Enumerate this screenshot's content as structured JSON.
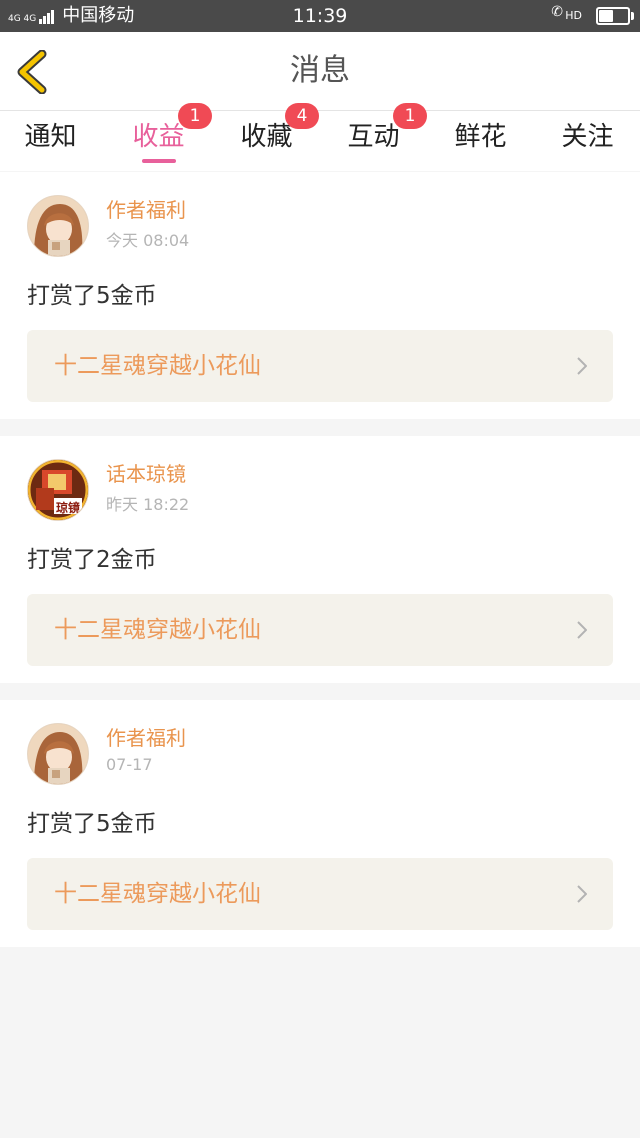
{
  "status_bar": {
    "network": "4G 4G",
    "carrier": "中国移动",
    "time": "11:39",
    "hd_label": "HD",
    "battery_level": 0.5
  },
  "header": {
    "title": "消息",
    "back_icon": "chevron-left-icon"
  },
  "tabs": [
    {
      "label": "通知",
      "badge": "",
      "active": false
    },
    {
      "label": "收益",
      "badge": "1",
      "active": true
    },
    {
      "label": "收藏",
      "badge": "4",
      "active": false
    },
    {
      "label": "互动",
      "badge": "1",
      "active": false
    },
    {
      "label": "鲜花",
      "badge": "",
      "active": false
    },
    {
      "label": "关注",
      "badge": "",
      "active": false
    }
  ],
  "messages": [
    {
      "sender": "作者福利",
      "time": "今天 08:04",
      "action": "打赏了5金币",
      "book": "十二星魂穿越小花仙"
    },
    {
      "sender": "话本琼镜",
      "time": "昨天 18:22",
      "action": "打赏了2金币",
      "book": "十二星魂穿越小花仙",
      "avatar_text": "琼镜"
    },
    {
      "sender": "作者福利",
      "time": "07-17",
      "action": "打赏了5金币",
      "book": "十二星魂穿越小花仙"
    }
  ],
  "colors": {
    "accent_pink": "#e8609b",
    "badge_red": "#f04a55",
    "sender_orange": "#e9944d",
    "book_orange": "#ec9a5b",
    "back_yellow": "#f5c400"
  }
}
